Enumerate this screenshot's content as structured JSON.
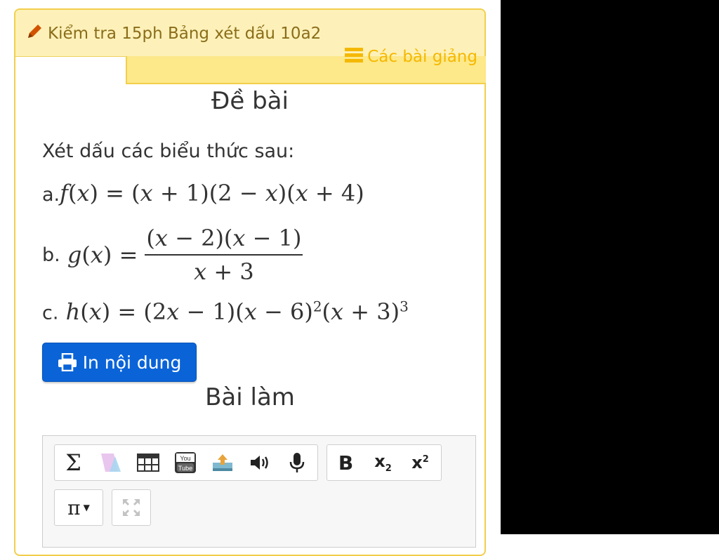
{
  "header": {
    "title": "Kiểm tra 15ph Bảng xét dấu 10a2",
    "lectures_link": "Các bài giảng"
  },
  "problem": {
    "heading": "Đề bài",
    "prompt": "Xét dấu các biểu thức sau:",
    "items": [
      {
        "label": "a.",
        "expr": "f(x) = (x + 1)(2 − x)(x + 4)"
      },
      {
        "label": "b.",
        "expr": "g(x) = (x − 2)(x − 1) / (x + 3)"
      },
      {
        "label": "c.",
        "expr": "h(x) = (2x − 1)(x − 6)²(x + 3)³"
      }
    ],
    "print_button": "In nội dung"
  },
  "answer": {
    "heading": "Bài làm",
    "toolbar": {
      "group1": [
        "sigma-icon",
        "shape-icon",
        "table-icon",
        "youtube-icon",
        "image-upload-icon",
        "speaker-icon",
        "microphone-icon"
      ],
      "group2": [
        "bold-icon",
        "subscript-icon",
        "superscript-icon"
      ],
      "pi_dropdown": "π",
      "fullscreen": "fullscreen-icon"
    }
  }
}
